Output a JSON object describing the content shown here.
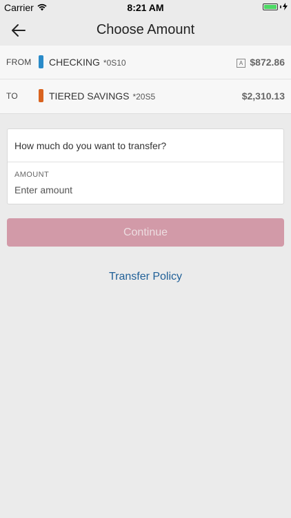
{
  "status_bar": {
    "carrier": "Carrier",
    "time": "8:21 AM",
    "battery_color": "#4cd964"
  },
  "nav": {
    "title": "Choose Amount",
    "back_icon": "arrow-left-icon"
  },
  "accounts": {
    "from": {
      "label": "FROM",
      "name": "CHECKING",
      "number": "*0S10",
      "balance": "$872.86",
      "badge": "A",
      "color": "#2a8bc9"
    },
    "to": {
      "label": "TO",
      "name": "TIERED SAVINGS",
      "number": "*20S5",
      "balance": "$2,310.13",
      "color": "#d9631f"
    }
  },
  "amount_card": {
    "question": "How much do you want to transfer?",
    "amount_label": "AMOUNT",
    "amount_placeholder": "Enter amount",
    "amount_value": ""
  },
  "continue_button": {
    "label": "Continue",
    "color": "#d29aa8"
  },
  "policy_link": {
    "label": "Transfer Policy",
    "color": "#1f5f97"
  }
}
